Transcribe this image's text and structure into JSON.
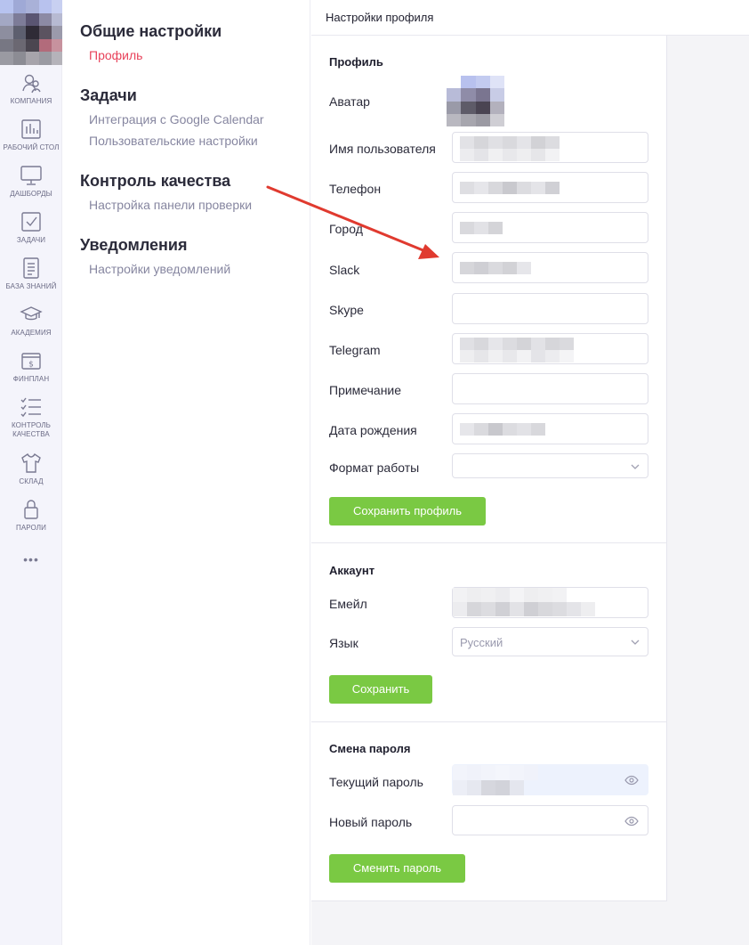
{
  "sidebar": {
    "items": [
      {
        "label": "КОМПАНИЯ",
        "icon": "company-icon"
      },
      {
        "label": "РАБОЧИЙ СТОЛ",
        "icon": "chart-bars-icon"
      },
      {
        "label": "ДАШБОРДЫ",
        "icon": "monitor-icon"
      },
      {
        "label": "ЗАДАЧИ",
        "icon": "checkbox-icon"
      },
      {
        "label": "БАЗА ЗНАНИЙ",
        "icon": "document-icon"
      },
      {
        "label": "АКАДЕМИЯ",
        "icon": "graduation-cap-icon"
      },
      {
        "label": "ФИНПЛАН",
        "icon": "dollar-icon"
      },
      {
        "label": "КОНТРОЛЬ КАЧЕСТВА",
        "icon": "checklist-icon"
      },
      {
        "label": "СКЛАД",
        "icon": "tshirt-icon"
      },
      {
        "label": "ПАРОЛИ",
        "icon": "lock-icon"
      }
    ],
    "more": "•••"
  },
  "nav": {
    "groups": [
      {
        "title": "Общие настройки",
        "links": [
          "Профиль"
        ]
      },
      {
        "title": "Задачи",
        "links": [
          "Интеграция с Google Calendar",
          "Пользовательские настройки"
        ]
      },
      {
        "title": "Контроль качества",
        "links": [
          "Настройка панели проверки"
        ]
      },
      {
        "title": "Уведомления",
        "links": [
          "Настройки уведомлений"
        ]
      }
    ],
    "active_link": "Профиль"
  },
  "header": {
    "title": "Настройки профиля"
  },
  "profile": {
    "section_title": "Профиль",
    "avatar_label": "Аватар",
    "fields": [
      {
        "label": "Имя пользователя",
        "value": ""
      },
      {
        "label": "Телефон",
        "value": ""
      },
      {
        "label": "Город",
        "value": ""
      },
      {
        "label": "Slack",
        "value": ""
      },
      {
        "label": "Skype",
        "value": ""
      },
      {
        "label": "Telegram",
        "value": ""
      },
      {
        "label": "Примечание",
        "value": ""
      },
      {
        "label": "Дата рождения",
        "value": ""
      },
      {
        "label": "Формат работы",
        "value": ""
      }
    ],
    "save_label": "Сохранить профиль"
  },
  "account": {
    "section_title": "Аккаунт",
    "email_label": "Емейл",
    "language_label": "Язык",
    "language_value": "Русский",
    "save_label": "Сохранить"
  },
  "password": {
    "section_title": "Смена пароля",
    "current_label": "Текущий пароль",
    "new_label": "Новый пароль",
    "submit_label": "Сменить пароль"
  },
  "colors": {
    "accent_active": "#e8435b",
    "button_green": "#7ac943",
    "annotation_arrow": "#e03a2f"
  }
}
